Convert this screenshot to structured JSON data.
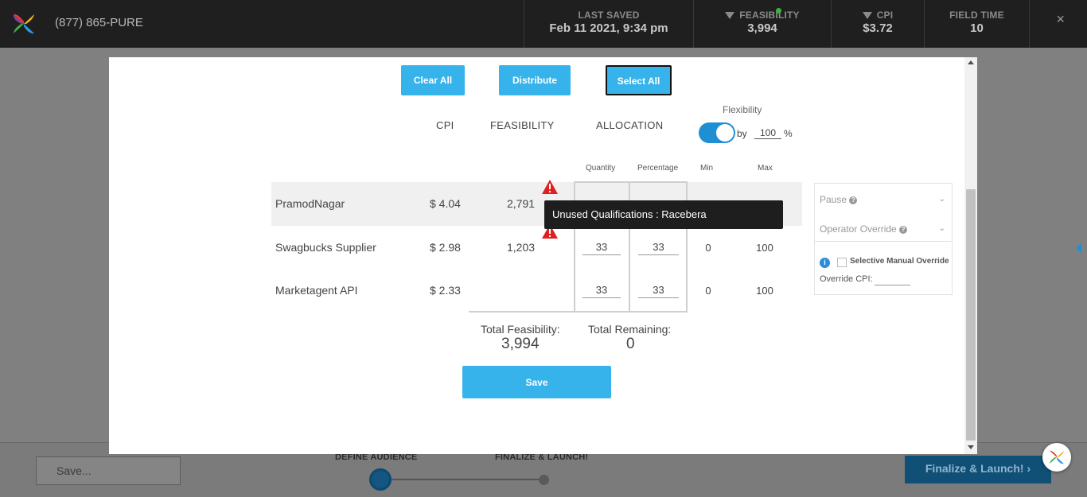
{
  "header": {
    "phone": "(877) 865-PURE",
    "last_saved_label": "LAST SAVED",
    "last_saved_value": "Feb 11 2021, 9:34 pm",
    "feasibility_label": "FEASIBILITY",
    "feasibility_value": "3,994",
    "cpi_label": "CPI",
    "cpi_value": "$3.72",
    "field_time_label": "FIELD TIME",
    "field_time_value": "10",
    "close": "×"
  },
  "toolbar": {
    "clear_all": "Clear All",
    "distribute": "Distribute",
    "select_all": "Select All"
  },
  "columns": {
    "cpi": "CPI",
    "feasibility": "FEASIBILITY",
    "allocation": "ALLOCATION",
    "quantity": "Quantity",
    "percentage": "Percentage",
    "min": "Min",
    "max": "Max"
  },
  "flexibility": {
    "label": "Flexibility",
    "by": "by",
    "value": "100",
    "unit": "%"
  },
  "suppliers": [
    {
      "name": "PramodNagar",
      "cpi": "$ 4.04",
      "feasibility": "2,791",
      "quantity": "",
      "percentage": "",
      "min": "",
      "max": ""
    },
    {
      "name": "Swagbucks Supplier",
      "cpi": "$ 2.98",
      "feasibility": "1,203",
      "quantity": "33",
      "percentage": "33",
      "min": "0",
      "max": "100"
    },
    {
      "name": "Marketagent API",
      "cpi": "$ 2.33",
      "feasibility": "",
      "quantity": "33",
      "percentage": "33",
      "min": "0",
      "max": "100"
    }
  ],
  "tooltip": "Unused Qualifications : Racebera",
  "totals": {
    "feasibility_label": "Total Feasibility:",
    "feasibility_value": "3,994",
    "remaining_label": "Total Remaining:",
    "remaining_value": "0"
  },
  "save_label": "Save",
  "side_panel": {
    "pause": "Pause",
    "operator_override": "Operator Override",
    "selective_manual_override": "Selective Manual Override",
    "override_cpi": "Override CPI:"
  },
  "bottom": {
    "save_placeholder": "Save...",
    "step1": "DEFINE AUDIENCE",
    "step2": "FINALIZE & LAUNCH!",
    "finalize": "Finalize & Launch!"
  },
  "colors": {
    "accent": "#36b3ea",
    "toggle": "#1f8fd3",
    "warning": "#e02020",
    "topbar": "#1f1f1f"
  },
  "icons": [
    "brand-logo-icon",
    "triangle-down-icon",
    "close-icon",
    "warning-icon",
    "chevron-down-icon",
    "question-icon",
    "info-icon"
  ]
}
